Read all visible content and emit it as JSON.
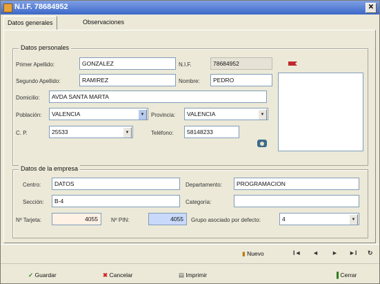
{
  "window": {
    "title": "N.I.F. 78684952"
  },
  "tabs": [
    {
      "label": "Datos generales"
    },
    {
      "label": "Observaciones"
    }
  ],
  "personal": {
    "group_title": "Datos personales",
    "labels": {
      "primer_apellido": "Primer Apellido:",
      "nif": "N.I.F.",
      "segundo_apellido": "Segundo Apellido:",
      "nombre": "Nombre:",
      "domicilio": "Domicilio:",
      "poblacion": "Población:",
      "provincia": "Provincia:",
      "cp": "C. P.",
      "telefono": "Teléfono:"
    },
    "values": {
      "primer_apellido": "GONZALEZ",
      "nif": "78684952",
      "segundo_apellido": "RAMIREZ",
      "nombre": "PEDRO",
      "domicilio": "AVDA SANTA MARTA",
      "poblacion": "VALENCIA",
      "provincia": "VALENCIA",
      "cp": "25533",
      "telefono": "58148233"
    }
  },
  "empresa": {
    "group_title": "Datos de la empresa",
    "labels": {
      "centro": "Centro:",
      "departamento": "Departamento:",
      "seccion": "Sección:",
      "categoria": "Categoría:",
      "tarjeta": "Nº Tarjeta:",
      "pin": "Nº PIN:",
      "grupo": "Grupo asociado por defecto:"
    },
    "values": {
      "centro": "DATOS",
      "departamento": "PROGRAMACION",
      "seccion": "B-4",
      "categoria": "",
      "tarjeta": "4055",
      "pin": "4055",
      "grupo": "4"
    }
  },
  "navigation": {
    "nuevo_label": "Nuevo",
    "first": "I◄",
    "prev": "◄",
    "next": "►",
    "last": "►I",
    "refresh": "↻"
  },
  "actions": {
    "guardar": "Guardar",
    "cancelar": "Cancelar",
    "imprimir": "Imprimir",
    "cerrar": "Cerrar"
  },
  "colors": {
    "title_bar": "#3b68c8",
    "tarjeta_bg": "#fff1e4",
    "pin_bg": "#c9d9fb"
  }
}
